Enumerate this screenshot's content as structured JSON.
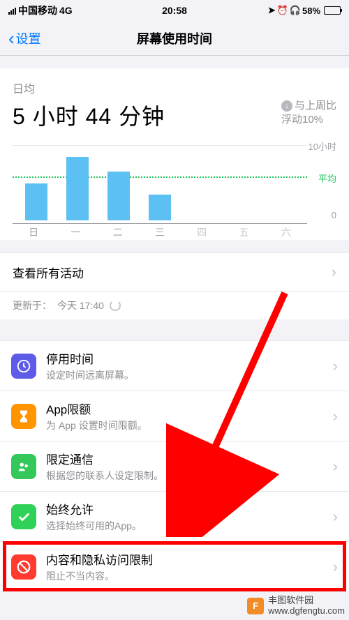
{
  "status": {
    "carrier": "中国移动",
    "network": "4G",
    "time": "20:58",
    "battery_pct": "58%"
  },
  "nav": {
    "back_label": "设置",
    "title": "屏幕使用时间"
  },
  "summary": {
    "daily_label": "日均",
    "avg_time": "5 小时 44 分钟",
    "delta_label_line1": "与上周比",
    "delta_label_line2": "浮动10%"
  },
  "chart_data": {
    "type": "bar",
    "categories": [
      "日",
      "一",
      "二",
      "三",
      "四",
      "五",
      "六"
    ],
    "values": [
      5.0,
      8.5,
      6.5,
      3.5,
      0,
      0,
      0
    ],
    "avg_value": 5.7,
    "ylim": [
      0,
      10
    ],
    "y_top_label": "10小时",
    "y_avg_label": "平均",
    "y_bot_label": "0"
  },
  "see_all": "查看所有活动",
  "updated": {
    "prefix": "更新于：",
    "time": "今天 17:40"
  },
  "list": {
    "downtime": {
      "title": "停用时间",
      "sub": "设定时间远离屏幕。"
    },
    "app_limits": {
      "title": "App限额",
      "sub": "为 App 设置时间限额。"
    },
    "communication": {
      "title": "限定通信",
      "sub": "根据您的联系人设定限制。"
    },
    "always_allowed": {
      "title": "始终允许",
      "sub": "选择始终可用的App。"
    },
    "content_privacy": {
      "title": "内容和隐私访问限制",
      "sub": "阻止不当内容。"
    }
  },
  "watermark": {
    "name": "丰图软件园",
    "url": "www.dgfengtu.com"
  }
}
